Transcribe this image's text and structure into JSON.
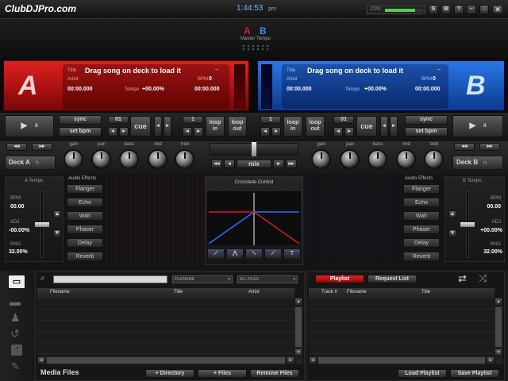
{
  "app": {
    "logo": "ClubDJPro.com",
    "time": "1:44:53",
    "ampm": "pm",
    "cpu_label": "CPU",
    "cpu_load": 0.8
  },
  "header": {
    "deck_a_letter": "A",
    "deck_b_letter": "B",
    "master_tempo": "Master Tempo"
  },
  "deckA": {
    "letter": "A",
    "title_label": "Title",
    "title": "Drag song on deck to load it",
    "dashes": "--",
    "artist_label": "Artist",
    "bpm_label": "BPM",
    "bpm": "0",
    "time_left": "00:00.000",
    "tempo_label": "Tempo",
    "tempo": "+00.00%",
    "time_right": "00:00.000"
  },
  "deckB": {
    "letter": "B",
    "title_label": "Title",
    "title": "Drag song on deck to load it",
    "dashes": "--",
    "artist_label": "Artist",
    "bpm_label": "BPM",
    "bpm": "0",
    "time_left": "00:00.000",
    "tempo_label": "Tempo",
    "tempo": "+00.00%",
    "time_right": "00:00.000"
  },
  "controls": {
    "sync": "sync",
    "set_bpm": "set bpm",
    "cue": "cue",
    "loop_in": "loop in",
    "loop_out": "loop out",
    "cue_num": "01",
    "loop_num": "1",
    "deck_a": "Deck A",
    "deck_b": "Deck B",
    "mix": "mix"
  },
  "eq": {
    "gain": "gain",
    "pan": "pan",
    "bass": "bass",
    "mid": "mid",
    "treb": "treb"
  },
  "tempoA": {
    "label": "A Tempo",
    "bpm_label": "BPM",
    "bpm": "00.00",
    "adj_label": "ADJ",
    "adj": "-00.00%",
    "rng_label": "RNG",
    "rng": "32.00%"
  },
  "tempoB": {
    "label": "B Tempo",
    "bpm_label": "BPM",
    "bpm": "00.00",
    "adj_label": "ADJ",
    "adj": "+00.00%",
    "rng_label": "RNG",
    "rng": "32.00%"
  },
  "effects": {
    "title": "Audio Effects",
    "items": [
      "Flanger",
      "Echo",
      "Wah",
      "Phaser",
      "Delay",
      "Reverb"
    ]
  },
  "crossfade": {
    "title": "Crossfade Control"
  },
  "media": {
    "filter1": "FILENAME",
    "filter2": "ALL FILES",
    "columns": [
      "Filename",
      "Title",
      "Artist"
    ],
    "title": "Media Files",
    "add_directory": "+ Directory",
    "add_files": "+ Files",
    "remove_files": "Remove Files"
  },
  "playlist": {
    "tab_playlist": "Playlist",
    "tab_request": "Request List",
    "columns": [
      "Track #",
      "Filename",
      "Title"
    ],
    "load": "Load Playlist",
    "save": "Save Playlist"
  },
  "colors": {
    "deckA": "#cc1010",
    "deckB": "#1a5fcc",
    "accent_red": "#e0201f"
  }
}
